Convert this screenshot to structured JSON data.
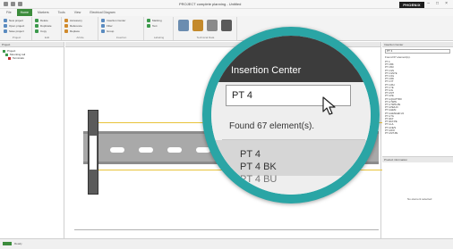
{
  "window": {
    "title": "PROJECT complete planning - Untitled",
    "logo_text": "PHOENIX",
    "controls": [
      "–",
      "□",
      "×"
    ]
  },
  "tabs": [
    {
      "label": "File"
    },
    {
      "label": "Home"
    },
    {
      "label": "Markers"
    },
    {
      "label": "Tools"
    },
    {
      "label": "View"
    },
    {
      "label": "Electrical Diagram"
    }
  ],
  "ribbon": {
    "groups": [
      {
        "label": "Project",
        "items": [
          "New project",
          "Open project",
          "Save project"
        ]
      },
      {
        "label": "Edit",
        "items": [
          "Delete",
          "Duplicate",
          "Copy"
        ]
      },
      {
        "label": "Article",
        "items": [
          "Accessory",
          "Reference",
          "Replace"
        ]
      },
      {
        "label": "Insertion",
        "items": [
          "Insertion Center",
          "Filter",
          "Group"
        ]
      },
      {
        "label": "Labeling",
        "items": [
          "Marking",
          "Text"
        ]
      },
      {
        "label": "Technical Data",
        "items": []
      }
    ]
  },
  "left_panel": {
    "header": "Project",
    "tree": [
      {
        "label": "Project",
        "color": "#3c9a4c"
      },
      {
        "label": "Mounting rail",
        "color": "#3c9a4c"
      },
      {
        "label": "Terminals",
        "color": "#c03030"
      }
    ]
  },
  "right_panel": {
    "header": "Insertion Center",
    "search_value": "PT 4",
    "found_text": "Found 67 element(s).",
    "results": [
      "PT 4",
      "PT 4 BK",
      "PT 4 BU",
      "PT 4 GN",
      "PT 4 GNYE",
      "PT 4 OG",
      "PT 4 RD",
      "PT 4 VT",
      "PT 4 WH",
      "PT 4 YE",
      "PT 4-3L",
      "PT 4-MT",
      "PT 4-PE",
      "PT 4-QUATTRO",
      "PT 4-TWIN",
      "PT 4-TWIN-PE",
      "PT 4-PE/L/N",
      "PT 4-HESI",
      "PT 4-HESILED 24",
      "PT 4-TG",
      "PT 4/1P",
      "PT 4/1P-PE",
      "PT 4-L/L",
      "PT 4-FE/S",
      "PT 4-DIO",
      "PT 4-MT-PE"
    ],
    "lower_header": "Product information",
    "no_element_text": "No element selected"
  },
  "magnifier": {
    "title": "Insertion Center",
    "search_value": "PT 4",
    "found_text": "Found 67 element(s).",
    "results": [
      "PT 4",
      "PT 4 BK",
      "PT 4 BU"
    ]
  },
  "status": {
    "text": "Ready"
  },
  "colors": {
    "accent": "#3c8c3c",
    "magnifier_ring": "#2aa5a5"
  }
}
